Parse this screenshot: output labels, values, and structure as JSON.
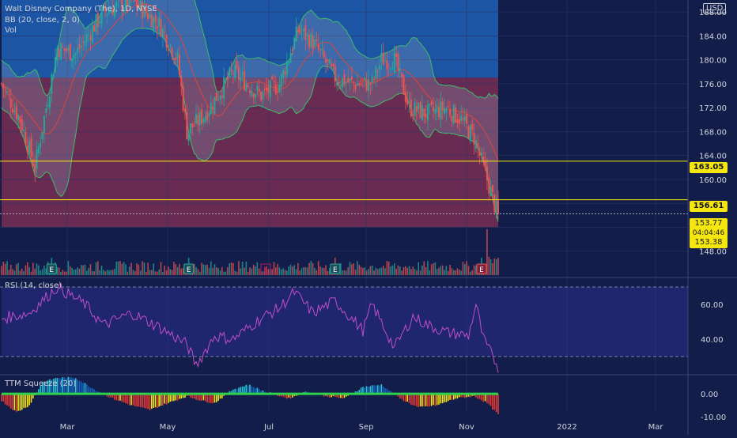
{
  "header": {
    "title": "Walt Disney Company (The), 1D, NYSE",
    "bb": "BB (20, close, 2, 0)",
    "vol": "Vol",
    "currency": "USD"
  },
  "price_tags": {
    "line1": "163.05",
    "line2": "156.61",
    "last": "153.77",
    "countdown": "04:04:46",
    "prev": "153.38"
  },
  "rsi_label": "RSI (14, close)",
  "squeeze_label": "TTM Squeeze (20)",
  "earnings_marker": "E",
  "colors": {
    "background": "#131d4a",
    "up": "#26a69a",
    "down": "#ef5350",
    "upper_zone": "#1f5fb4",
    "lower_zone": "#7a2e55",
    "hline": "#f5e60f",
    "rsi": "#c04ec8",
    "bb_band": "#3ebc68",
    "bb_mid": "#e0453a"
  },
  "chart_data": [
    {
      "type": "candlestick",
      "name": "price",
      "ylim": [
        144,
        190
      ],
      "yticks": [
        148,
        152,
        156,
        160,
        164,
        168,
        172,
        176,
        180,
        184,
        188
      ],
      "ytick_labels": [
        "148.00",
        "152.00",
        "156.00",
        "160.00",
        "164.00",
        "168.00",
        "172.00",
        "176.00",
        "180.00",
        "184.00",
        "188.00"
      ],
      "x_labels": [
        "Mar",
        "May",
        "Jul",
        "Sep",
        "Nov",
        "2022",
        "Mar"
      ],
      "hlines": [
        163.05,
        156.61
      ],
      "zones": [
        {
          "from": 177,
          "to": 190,
          "color": "upper_zone"
        },
        {
          "from": 152,
          "to": 177,
          "color": "lower_zone"
        }
      ],
      "anchors": [
        [
          0,
          176
        ],
        [
          10,
          170
        ],
        [
          18,
          162
        ],
        [
          30,
          182
        ],
        [
          40,
          181
        ],
        [
          55,
          188
        ],
        [
          70,
          190
        ],
        [
          85,
          186
        ],
        [
          95,
          180
        ],
        [
          100,
          168
        ],
        [
          110,
          171
        ],
        [
          125,
          178
        ],
        [
          140,
          174
        ],
        [
          150,
          176
        ],
        [
          160,
          185
        ],
        [
          168,
          183
        ],
        [
          180,
          177
        ],
        [
          190,
          176
        ],
        [
          200,
          176
        ],
        [
          205,
          180
        ],
        [
          212,
          180
        ],
        [
          220,
          172
        ],
        [
          230,
          171
        ],
        [
          240,
          172
        ],
        [
          248,
          170
        ],
        [
          255,
          167
        ],
        [
          262,
          160
        ],
        [
          268,
          153.77
        ]
      ],
      "earnings_idx": [
        27,
        101,
        180,
        259
      ],
      "future_earnings_pos": 336
    },
    {
      "type": "line",
      "name": "RSI",
      "ylim": [
        20,
        75
      ],
      "yticks": [
        40,
        60
      ],
      "ytick_labels": [
        "40.00",
        "60.00"
      ],
      "band": [
        30,
        70
      ],
      "anchors": [
        [
          0,
          52
        ],
        [
          15,
          55
        ],
        [
          30,
          70
        ],
        [
          45,
          60
        ],
        [
          55,
          48
        ],
        [
          70,
          55
        ],
        [
          85,
          47
        ],
        [
          100,
          37
        ],
        [
          105,
          25
        ],
        [
          115,
          42
        ],
        [
          125,
          40
        ],
        [
          140,
          52
        ],
        [
          150,
          58
        ],
        [
          158,
          67
        ],
        [
          168,
          55
        ],
        [
          180,
          62
        ],
        [
          195,
          45
        ],
        [
          200,
          60
        ],
        [
          212,
          35
        ],
        [
          222,
          53
        ],
        [
          230,
          48
        ],
        [
          240,
          44
        ],
        [
          252,
          42
        ],
        [
          256,
          60
        ],
        [
          260,
          40
        ],
        [
          268,
          24
        ]
      ]
    },
    {
      "type": "histogram",
      "name": "TTM Squeeze",
      "ylim": [
        -11,
        8
      ],
      "yticks": [
        0,
        -10
      ],
      "ytick_labels": [
        "0.00",
        "-10.00"
      ],
      "anchors": [
        [
          0,
          -3
        ],
        [
          8,
          -8
        ],
        [
          15,
          -5
        ],
        [
          22,
          5
        ],
        [
          30,
          7
        ],
        [
          40,
          7
        ],
        [
          50,
          2
        ],
        [
          60,
          -2
        ],
        [
          70,
          -5
        ],
        [
          80,
          -7
        ],
        [
          90,
          -4
        ],
        [
          100,
          -1
        ],
        [
          108,
          -3
        ],
        [
          115,
          -4
        ],
        [
          125,
          2
        ],
        [
          133,
          4
        ],
        [
          142,
          1
        ],
        [
          155,
          -2
        ],
        [
          165,
          1
        ],
        [
          175,
          -1
        ],
        [
          185,
          -2
        ],
        [
          195,
          3
        ],
        [
          205,
          4
        ],
        [
          215,
          -2
        ],
        [
          225,
          -6
        ],
        [
          235,
          -5
        ],
        [
          245,
          -2
        ],
        [
          255,
          -1
        ],
        [
          262,
          -4
        ],
        [
          268,
          -9
        ]
      ]
    }
  ]
}
